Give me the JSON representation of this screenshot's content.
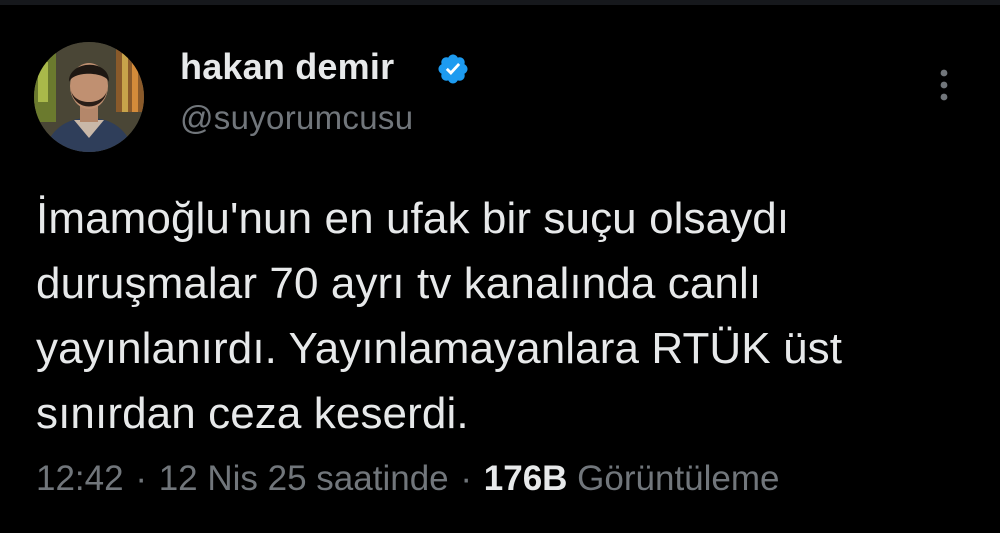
{
  "tweet": {
    "author": {
      "display_name": "hakan demir",
      "username": "@suyorumcusu",
      "verified_icon": "verified-badge-icon",
      "avatar": "profile-photo"
    },
    "text_lines": [
      "İmamoğlu'nun en ufak bir suçu olsaydı",
      "duruşmalar 70 ayrı tv kanalında canlı",
      "yayınlanırdı. Yayınlamayanlara RTÜK üst",
      "sınırdan ceza keserdi."
    ],
    "meta": {
      "time": "12:42",
      "separator": "·",
      "date": "12 Nis 25 saatinde",
      "views_count": "176B",
      "views_label": "Görüntüleme"
    },
    "more_menu_icon": "more-vertical-icon"
  },
  "colors": {
    "background": "#000000",
    "text_primary": "#e7e9ea",
    "text_secondary": "#71767b",
    "verified_blue": "#1d9bf0"
  }
}
